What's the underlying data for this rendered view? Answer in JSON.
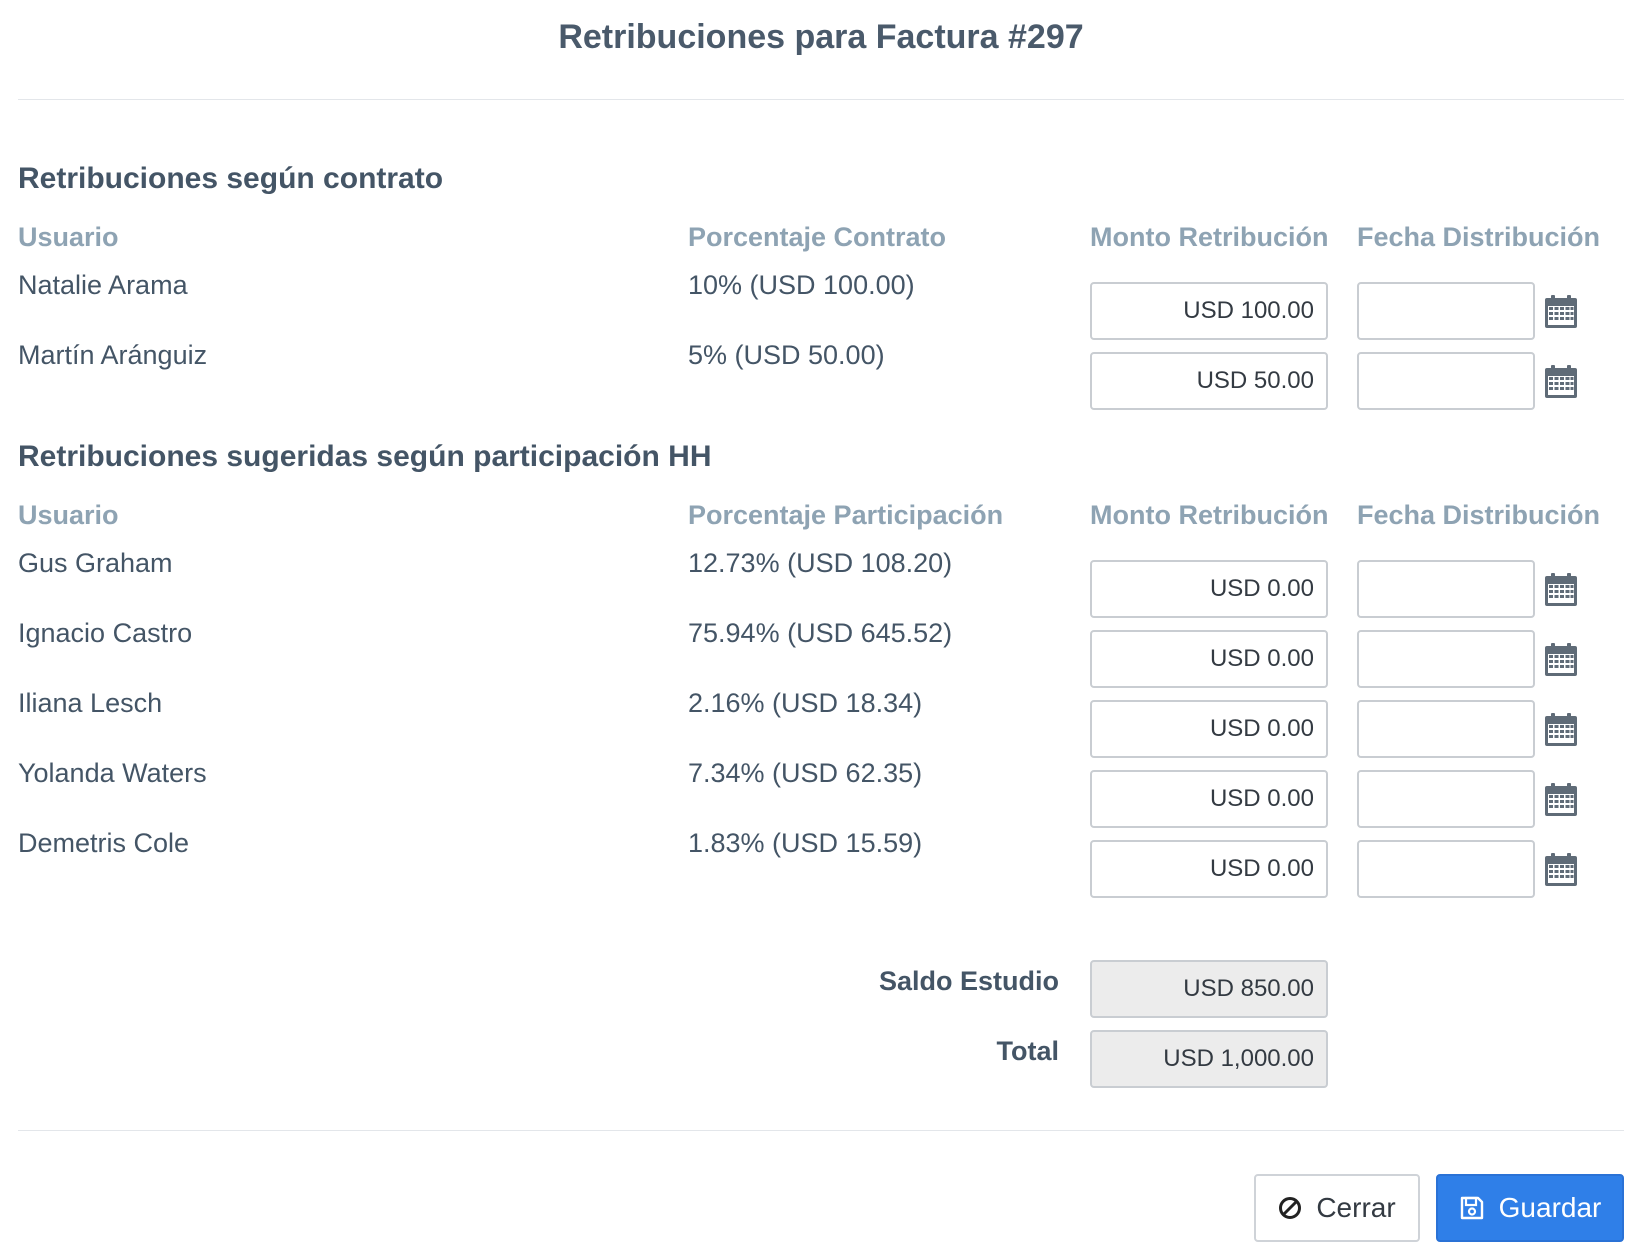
{
  "modal": {
    "title": "Retribuciones para Factura #297"
  },
  "contract": {
    "section_title": "Retribuciones según contrato",
    "headers": {
      "user": "Usuario",
      "percent": "Porcentaje Contrato",
      "amount": "Monto Retribución",
      "date": "Fecha Distribución"
    },
    "rows": [
      {
        "user": "Natalie Arama",
        "percent": "10% (USD 100.00)",
        "amount": "USD 100.00",
        "date": ""
      },
      {
        "user": "Martín Aránguiz",
        "percent": "5% (USD 50.00)",
        "amount": "USD 50.00",
        "date": ""
      }
    ]
  },
  "participation": {
    "section_title": "Retribuciones sugeridas según participación HH",
    "headers": {
      "user": "Usuario",
      "percent": "Porcentaje Participación",
      "amount": "Monto Retribución",
      "date": "Fecha Distribución"
    },
    "rows": [
      {
        "user": "Gus Graham",
        "percent": "12.73% (USD 108.20)",
        "amount": "USD 0.00",
        "date": ""
      },
      {
        "user": "Ignacio Castro",
        "percent": "75.94% (USD 645.52)",
        "amount": "USD 0.00",
        "date": ""
      },
      {
        "user": "Iliana Lesch",
        "percent": "2.16% (USD 18.34)",
        "amount": "USD 0.00",
        "date": ""
      },
      {
        "user": "Yolanda Waters",
        "percent": "7.34% (USD 62.35)",
        "amount": "USD 0.00",
        "date": ""
      },
      {
        "user": "Demetris Cole",
        "percent": "1.83% (USD 15.59)",
        "amount": "USD 0.00",
        "date": ""
      }
    ]
  },
  "totals": {
    "balance_label": "Saldo Estudio",
    "balance_value": "USD 850.00",
    "total_label": "Total",
    "total_value": "USD 1,000.00"
  },
  "footer": {
    "close_label": "Cerrar",
    "save_label": "Guardar"
  },
  "icons": {
    "calendar": "calendar-icon",
    "close": "ban-icon",
    "save": "floppy-disk-icon"
  },
  "colors": {
    "primary": "#2f7fe8",
    "header_text": "#8ea3b3",
    "body_text": "#445566"
  }
}
